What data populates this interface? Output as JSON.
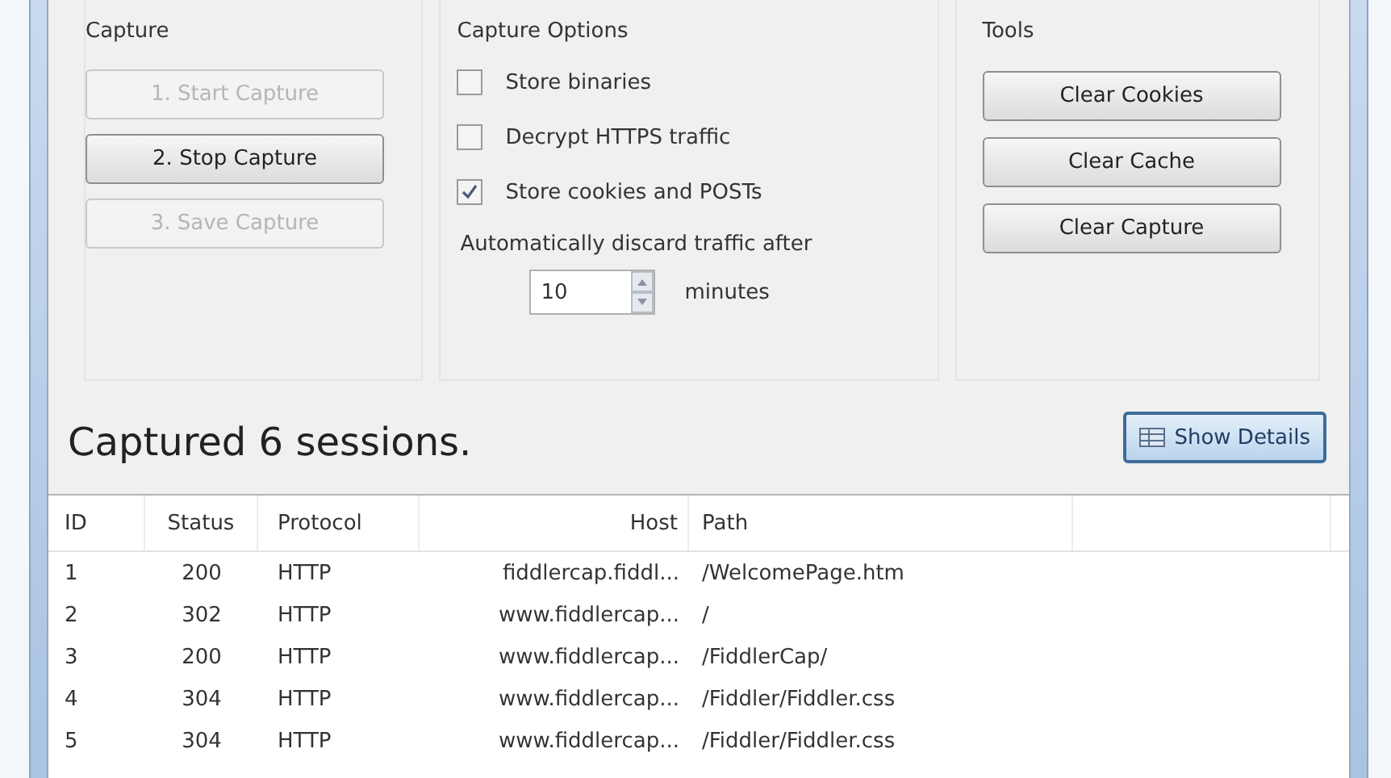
{
  "capture": {
    "title": "Capture",
    "buttons": [
      {
        "label": "1. Start Capture",
        "disabled": true
      },
      {
        "label": "2. Stop Capture",
        "disabled": false
      },
      {
        "label": "3. Save Capture",
        "disabled": true
      }
    ]
  },
  "capture_options": {
    "title": "Capture Options",
    "checkboxes": [
      {
        "label": "Store binaries",
        "checked": false
      },
      {
        "label": "Decrypt HTTPS traffic",
        "checked": false
      },
      {
        "label": "Store cookies and POSTs",
        "checked": true
      }
    ],
    "discard_label": "Automatically discard traffic after",
    "minutes_value": "10",
    "minutes_unit": "minutes"
  },
  "tools": {
    "title": "Tools",
    "buttons": [
      "Clear Cookies",
      "Clear Cache",
      "Clear Capture"
    ]
  },
  "summary": "Captured 6 sessions.",
  "show_details_button": "Show Details",
  "table": {
    "columns": [
      "ID",
      "Status",
      "Protocol",
      "Host",
      "Path"
    ],
    "rows": [
      [
        "1",
        "200",
        "HTTP",
        "fiddlercap.fiddl...",
        "/WelcomePage.htm"
      ],
      [
        "2",
        "302",
        "HTTP",
        "www.fiddlercap...",
        "/"
      ],
      [
        "3",
        "200",
        "HTTP",
        "www.fiddlercap...",
        "/FiddlerCap/"
      ],
      [
        "4",
        "304",
        "HTTP",
        "www.fiddlercap...",
        "/Fiddler/Fiddler.css"
      ],
      [
        "5",
        "304",
        "HTTP",
        "www.fiddlercap...",
        "/Fiddler/Fiddler.css"
      ]
    ]
  }
}
